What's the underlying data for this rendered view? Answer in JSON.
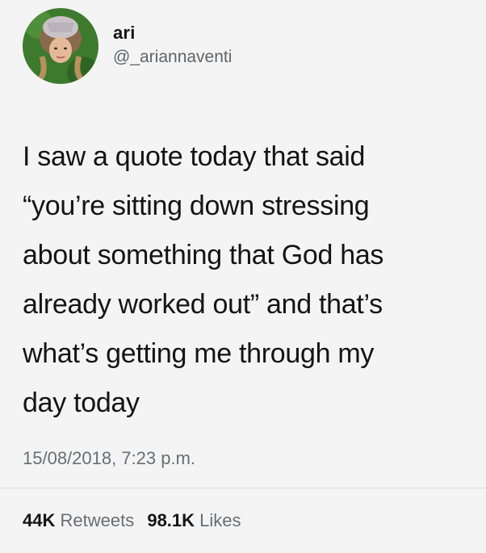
{
  "user": {
    "display_name": "ari",
    "handle": "@_ariannaventi"
  },
  "tweet": {
    "text": "I saw a quote today that said\n“you’re sitting down stressing\nabout something that God has\nalready worked out” and that’s\nwhat’s getting me through my\nday today",
    "timestamp": "15/08/2018, 7:23 p.m."
  },
  "stats": {
    "retweets_count": "44K",
    "retweets_label": "Retweets",
    "likes_count": "98.1K",
    "likes_label": "Likes"
  },
  "colors": {
    "background": "#f4f4f4",
    "text": "#141414",
    "secondary_text": "#6a6e72",
    "divider": "#dcdcdc"
  },
  "icons": {
    "avatar": "profile-photo"
  }
}
